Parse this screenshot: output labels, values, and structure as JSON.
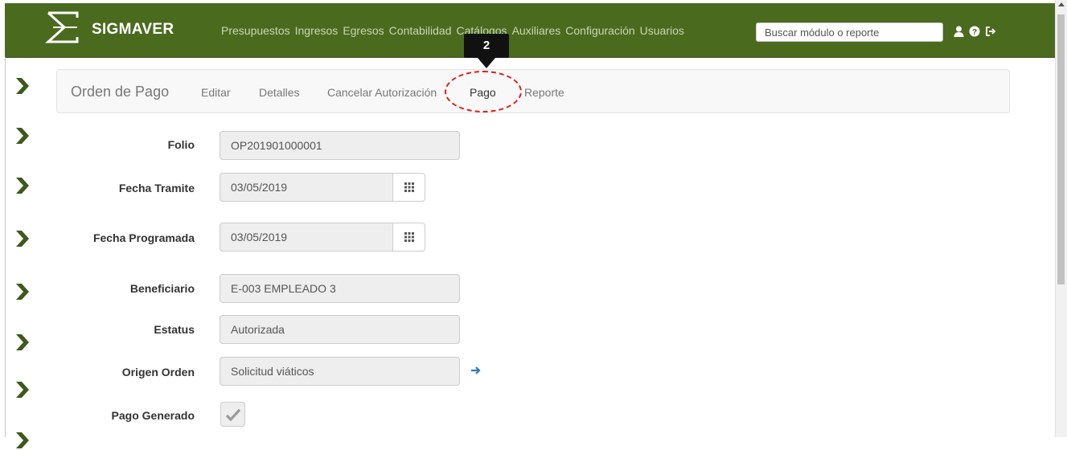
{
  "app": {
    "brand": "SIGMAVER",
    "menu": [
      "Presupuestos",
      "Ingresos",
      "Egresos",
      "Contabilidad",
      "Catálogos",
      "Auxiliares",
      "Configuración",
      "Usuarios"
    ],
    "search_placeholder": "Buscar módulo o reporte",
    "nav_icons": [
      "user-icon",
      "help-icon",
      "logout-icon"
    ],
    "colors": {
      "navbar": "#4a6b1e",
      "chevron": "#3d5a1a",
      "callout_border": "#e02020"
    }
  },
  "subnav": {
    "title": "Orden de Pago",
    "links": [
      "Editar",
      "Detalles",
      "Cancelar Autorización",
      "Pago",
      "Reporte"
    ],
    "highlighted": "Pago"
  },
  "callout": {
    "label": "2"
  },
  "form": {
    "folio": {
      "label": "Folio",
      "value": "OP201901000001"
    },
    "fecha_tramite": {
      "label": "Fecha Tramite",
      "value": "03/05/2019"
    },
    "fecha_programada": {
      "label": "Fecha Programada",
      "value": "03/05/2019"
    },
    "beneficiario": {
      "label": "Beneficiario",
      "value": "E-003 EMPLEADO 3"
    },
    "estatus": {
      "label": "Estatus",
      "value": "Autorizada"
    },
    "origen_orden": {
      "label": "Origen Orden",
      "value": "Solicitud viáticos"
    },
    "pago_generado": {
      "label": "Pago Generado",
      "checked": true
    }
  }
}
